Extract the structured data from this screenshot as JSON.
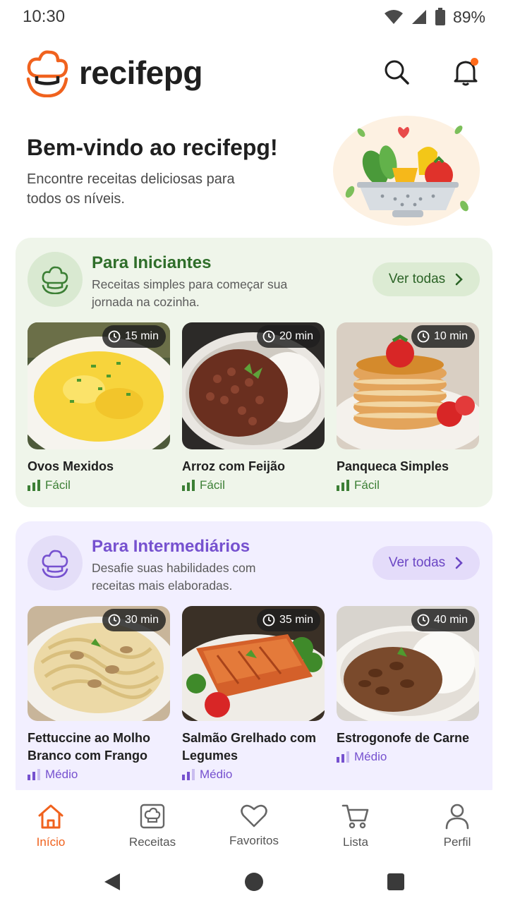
{
  "status": {
    "time": "10:30",
    "battery": "89%"
  },
  "header": {
    "app_name": "recifepg",
    "search_icon": "search-icon",
    "notification_icon": "bell-icon",
    "accent": "#f0621e"
  },
  "hero": {
    "title": "Bem-vindo ao recifepg!",
    "subtitle": "Encontre receitas deliciosas para todos os níveis."
  },
  "beginner": {
    "title": "Para Iniciantes",
    "description": "Receitas simples para começar sua jornada na cozinha.",
    "see_all": "Ver todas",
    "color": "#2f6e2a",
    "recipes": [
      {
        "name": "Ovos Mexidos",
        "time": "15 min",
        "level": "Fácil"
      },
      {
        "name": "Arroz com Feijão",
        "time": "20 min",
        "level": "Fácil"
      },
      {
        "name": "Panqueca Simples",
        "time": "10 min",
        "level": "Fácil"
      }
    ]
  },
  "intermediate": {
    "title": "Para Intermediários",
    "description": "Desafie suas habilidades com receitas mais elaboradas.",
    "see_all": "Ver todas",
    "color": "#7651cf",
    "recipes": [
      {
        "name": "Fettuccine ao Molho Branco com Frango",
        "time": "30 min",
        "level": "Médio"
      },
      {
        "name": "Salmão Grelhado com Legumes",
        "time": "35 min",
        "level": "Médio"
      },
      {
        "name": "Estrogonofe de Carne",
        "time": "40 min",
        "level": "Médio"
      }
    ]
  },
  "nav": {
    "items": [
      {
        "label": "Início",
        "icon": "home-icon",
        "active": true
      },
      {
        "label": "Receitas",
        "icon": "chef-hat-icon",
        "active": false
      },
      {
        "label": "Favoritos",
        "icon": "heart-icon",
        "active": false
      },
      {
        "label": "Lista",
        "icon": "cart-icon",
        "active": false
      },
      {
        "label": "Perfil",
        "icon": "profile-icon",
        "active": false
      }
    ]
  }
}
